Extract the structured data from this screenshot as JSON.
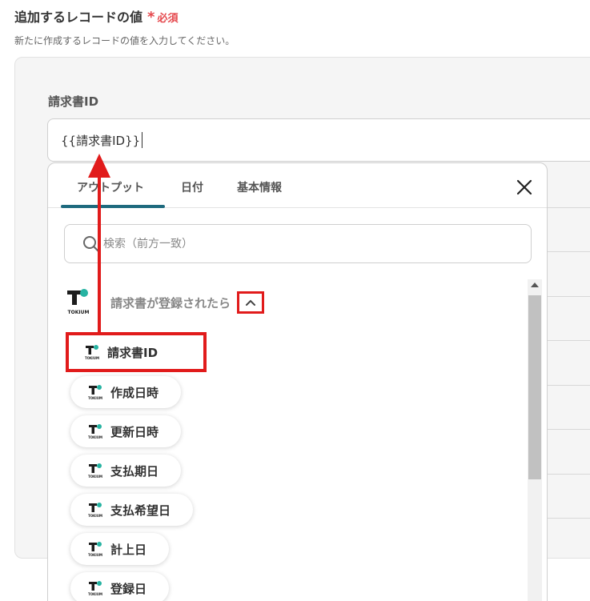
{
  "section": {
    "title": "追加するレコードの値",
    "required_mark": "*",
    "required_text": "必須",
    "description": "新たに作成するレコードの値を入力してください。"
  },
  "field": {
    "label": "請求書ID",
    "value": "{{請求書ID}}"
  },
  "dropdown": {
    "tabs": [
      {
        "label": "アウトプット",
        "active": true
      },
      {
        "label": "日付",
        "active": false
      },
      {
        "label": "基本情報",
        "active": false
      }
    ],
    "search_placeholder": "検索（前方一致）",
    "group_title": "請求書が登録されたら",
    "items": [
      {
        "label": "請求書ID",
        "highlighted": true
      },
      {
        "label": "作成日時",
        "highlighted": false
      },
      {
        "label": "更新日時",
        "highlighted": false
      },
      {
        "label": "支払期日",
        "highlighted": false
      },
      {
        "label": "支払希望日",
        "highlighted": false
      },
      {
        "label": "計上日",
        "highlighted": false
      },
      {
        "label": "登録日",
        "highlighted": false
      }
    ]
  },
  "colors": {
    "accent": "#1e6a7e",
    "required": "#e5484d",
    "annotation": "#e11b1b",
    "logo_teal": "#27b3a2"
  },
  "icons": {
    "search": "search-icon",
    "close": "close-icon",
    "chevron": "chevron-up-icon",
    "logo": "tokium-logo-icon"
  }
}
